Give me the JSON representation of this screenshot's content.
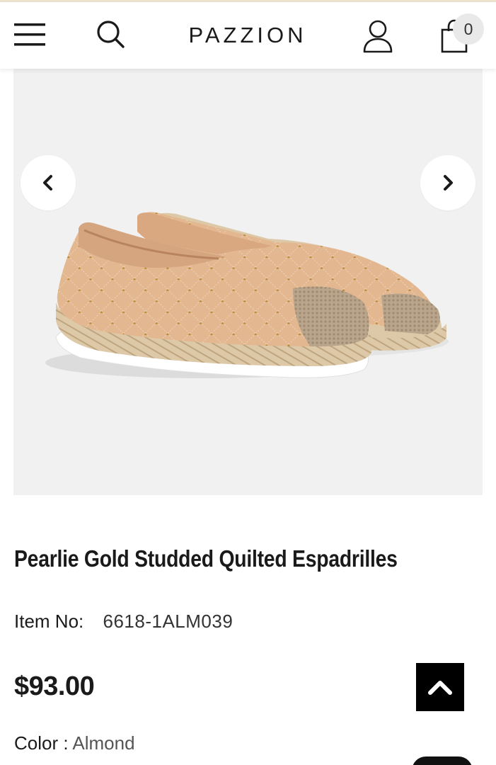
{
  "header": {
    "logo_text": "PAZZION",
    "cart_count": "0",
    "icons": [
      "hamburger-menu-icon",
      "search-icon",
      "user-icon",
      "shopping-bag-icon"
    ]
  },
  "gallery": {
    "prev_icon": "chevron-left-icon",
    "next_icon": "chevron-right-icon",
    "background_color": "#f1f1f1"
  },
  "product": {
    "title": "Pearlie Gold Studded Quilted Espadrilles",
    "item_no_label": "Item No:",
    "item_no_value": "6618-1ALM039",
    "price": "$93.00",
    "color_label": "Color : ",
    "color_value": "Almond"
  },
  "floating": {
    "back_to_top_icon": "chevron-up-icon",
    "accent_color": "#000000"
  }
}
